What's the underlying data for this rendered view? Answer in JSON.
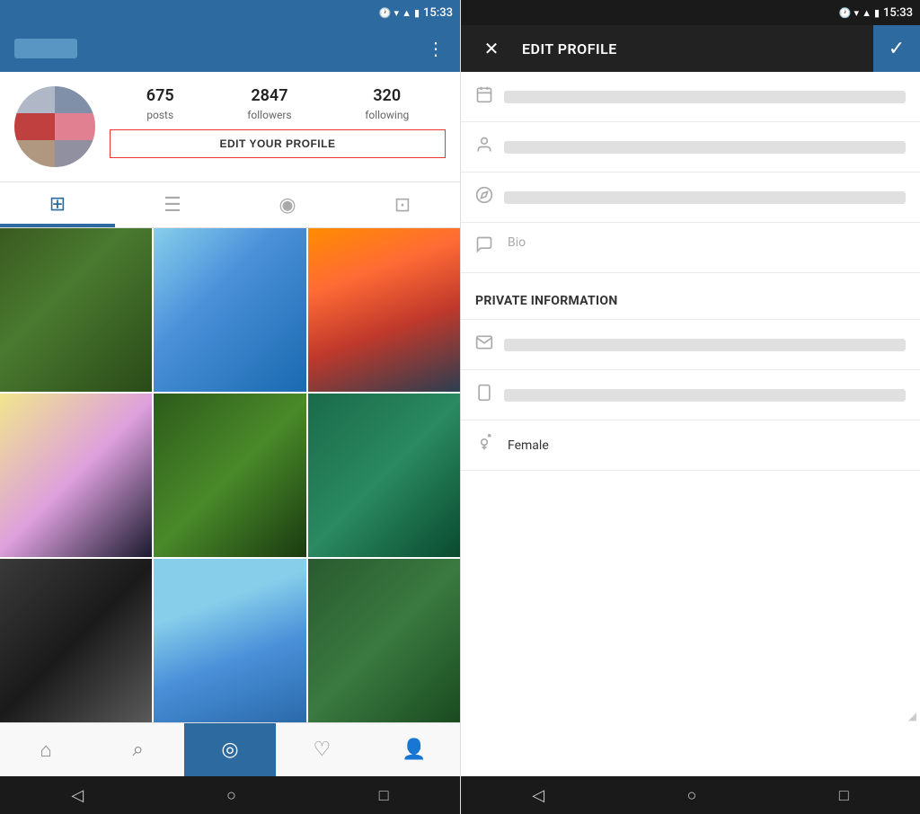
{
  "left": {
    "statusBar": {
      "time": "15:33",
      "icons": [
        "alarm",
        "wifi",
        "signal",
        "battery"
      ]
    },
    "topBar": {
      "menuLabel": "⋮"
    },
    "profile": {
      "stats": [
        {
          "number": "675",
          "label": "posts"
        },
        {
          "number": "2847",
          "label": "followers"
        },
        {
          "number": "320",
          "label": "following"
        }
      ],
      "editButtonLabel": "EDIT YOUR PROFILE"
    },
    "tabs": [
      {
        "icon": "⊞",
        "label": "grid-view",
        "active": true
      },
      {
        "icon": "☰",
        "label": "list-view",
        "active": false
      },
      {
        "icon": "◉",
        "label": "location-view",
        "active": false
      },
      {
        "icon": "⊡",
        "label": "tag-view",
        "active": false
      }
    ],
    "bottomNav": [
      {
        "icon": "⌂",
        "label": "home",
        "active": false
      },
      {
        "icon": "⌕",
        "label": "search",
        "active": false
      },
      {
        "icon": "◎",
        "label": "camera",
        "active": true
      },
      {
        "icon": "♡",
        "label": "activity",
        "active": false
      },
      {
        "icon": "👤",
        "label": "profile",
        "active": false
      }
    ],
    "sysNav": [
      {
        "icon": "◁",
        "label": "back"
      },
      {
        "icon": "○",
        "label": "home"
      },
      {
        "icon": "□",
        "label": "recents"
      }
    ]
  },
  "right": {
    "statusBar": {
      "time": "15:33"
    },
    "header": {
      "closeLabel": "✕",
      "title": "EDIT PROFILE",
      "confirmLabel": "✓"
    },
    "form": {
      "rows": [
        {
          "icon": "📅",
          "iconName": "calendar-icon",
          "placeholderWidth": 140
        },
        {
          "icon": "👤",
          "iconName": "person-icon",
          "placeholderWidth": 80
        },
        {
          "icon": "🔗",
          "iconName": "link-icon",
          "placeholderWidth": 170
        }
      ],
      "bioLabel": "Bio",
      "privateSection": {
        "title": "PRIVATE INFORMATION",
        "rows": [
          {
            "icon": "✉",
            "iconName": "email-icon",
            "placeholderWidth": 190
          },
          {
            "icon": "📱",
            "iconName": "phone-icon",
            "placeholderWidth": 120
          }
        ],
        "genderLabel": "Female",
        "genderIconName": "gender-icon"
      }
    },
    "sysNav": [
      {
        "icon": "◁",
        "label": "back"
      },
      {
        "icon": "○",
        "label": "home"
      },
      {
        "icon": "□",
        "label": "recents"
      }
    ]
  }
}
